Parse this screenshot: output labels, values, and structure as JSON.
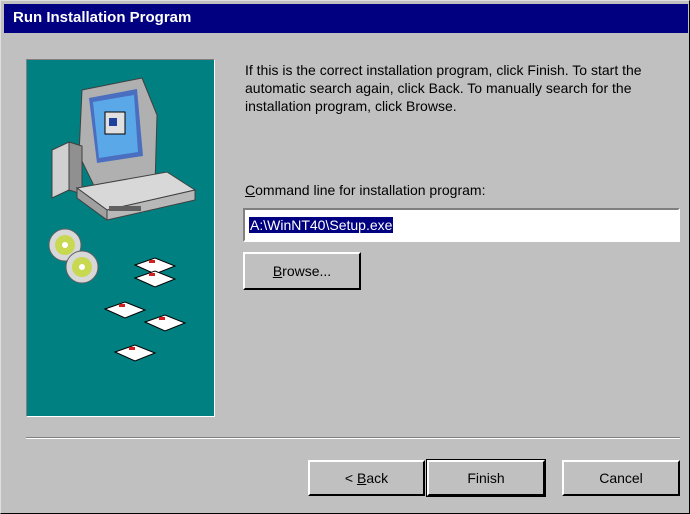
{
  "window": {
    "title": "Run Installation Program"
  },
  "instructions": "If this is the correct installation program, click Finish. To start the automatic search again, click Back. To manually search for the installation program, click Browse.",
  "command_line": {
    "label_first_char": "C",
    "label_rest": "ommand line for installation program:",
    "value": "A:\\WinNT40\\Setup.exe"
  },
  "buttons": {
    "browse_first": "B",
    "browse_rest": "rowse...",
    "back_prefix": "< ",
    "back_first": "B",
    "back_rest": "ack",
    "finish": "Finish",
    "cancel": "Cancel"
  },
  "colors": {
    "title_bar": "#000080",
    "art_background": "#008080",
    "face": "#c0c0c0"
  }
}
